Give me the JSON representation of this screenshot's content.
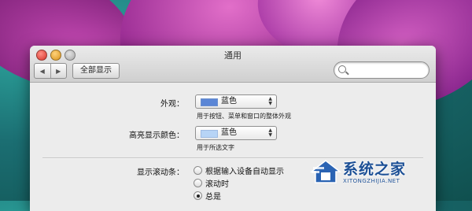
{
  "window": {
    "title": "通用"
  },
  "toolbar": {
    "back_icon": "back-arrow",
    "forward_icon": "forward-arrow",
    "show_all_label": "全部显示",
    "search": {
      "value": "",
      "placeholder": ""
    }
  },
  "appearance": {
    "label": "外观：",
    "selected": "蓝色",
    "hint": "用于按钮、菜单和窗口的整体外观",
    "swatch_color": "#5b86d6"
  },
  "highlight": {
    "label": "高亮显示颜色：",
    "selected": "蓝色",
    "hint": "用于所选文字",
    "swatch_color": "#b7d4f6"
  },
  "scrollbars": {
    "label": "显示滚动条：",
    "options": [
      {
        "label": "根据输入设备自动显示",
        "selected": false
      },
      {
        "label": "滚动时",
        "selected": false
      },
      {
        "label": "总是",
        "selected": true
      }
    ]
  },
  "watermark": {
    "title": "系统之家",
    "url": "XITONGZHIJIA.NET"
  }
}
